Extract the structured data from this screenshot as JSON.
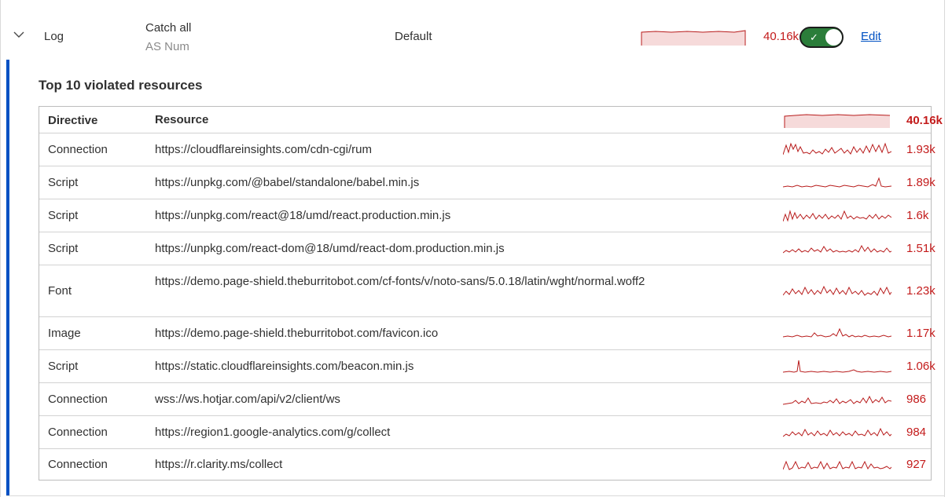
{
  "rule": {
    "action": "Log",
    "description_title": "Catch all",
    "description_sub": "AS Num",
    "type": "Default",
    "count": "40.16k",
    "enabled": true,
    "edit_label": "Edit",
    "toggle_check": "✓"
  },
  "section": {
    "title": "Top 10 violated resources"
  },
  "table": {
    "header": {
      "directive": "Directive",
      "resource": "Resource",
      "count": "40.16k"
    },
    "rows": [
      {
        "directive": "Connection",
        "resource": "https://cloudflareinsights.com/cdn-cgi/rum",
        "count": "1.93k"
      },
      {
        "directive": "Script",
        "resource": "https://unpkg.com/@babel/standalone/babel.min.js",
        "count": "1.89k"
      },
      {
        "directive": "Script",
        "resource": "https://unpkg.com/react@18/umd/react.production.min.js",
        "count": "1.6k"
      },
      {
        "directive": "Script",
        "resource": "https://unpkg.com/react-dom@18/umd/react-dom.production.min.js",
        "count": "1.51k"
      },
      {
        "directive": "Font",
        "resource": "https://demo.page-shield.theburritobot.com/cf-fonts/v/noto-sans/5.0.18/latin/wght/normal.woff2",
        "count": "1.23k"
      },
      {
        "directive": "Image",
        "resource": "https://demo.page-shield.theburritobot.com/favicon.ico",
        "count": "1.17k"
      },
      {
        "directive": "Script",
        "resource": "https://static.cloudflareinsights.com/beacon.min.js",
        "count": "1.06k"
      },
      {
        "directive": "Connection",
        "resource": "wss://ws.hotjar.com/api/v2/client/ws",
        "count": "986"
      },
      {
        "directive": "Connection",
        "resource": "https://region1.google-analytics.com/g/collect",
        "count": "984"
      },
      {
        "directive": "Connection",
        "resource": "https://r.clarity.ms/collect",
        "count": "927"
      }
    ]
  },
  "colors": {
    "accent": "#0051c3",
    "count_red": "#c31b1b",
    "toggle_on": "#2b7d3a",
    "sparkline": "#b81c1c"
  },
  "icons": [
    "chevron-down-icon",
    "check-icon"
  ]
}
